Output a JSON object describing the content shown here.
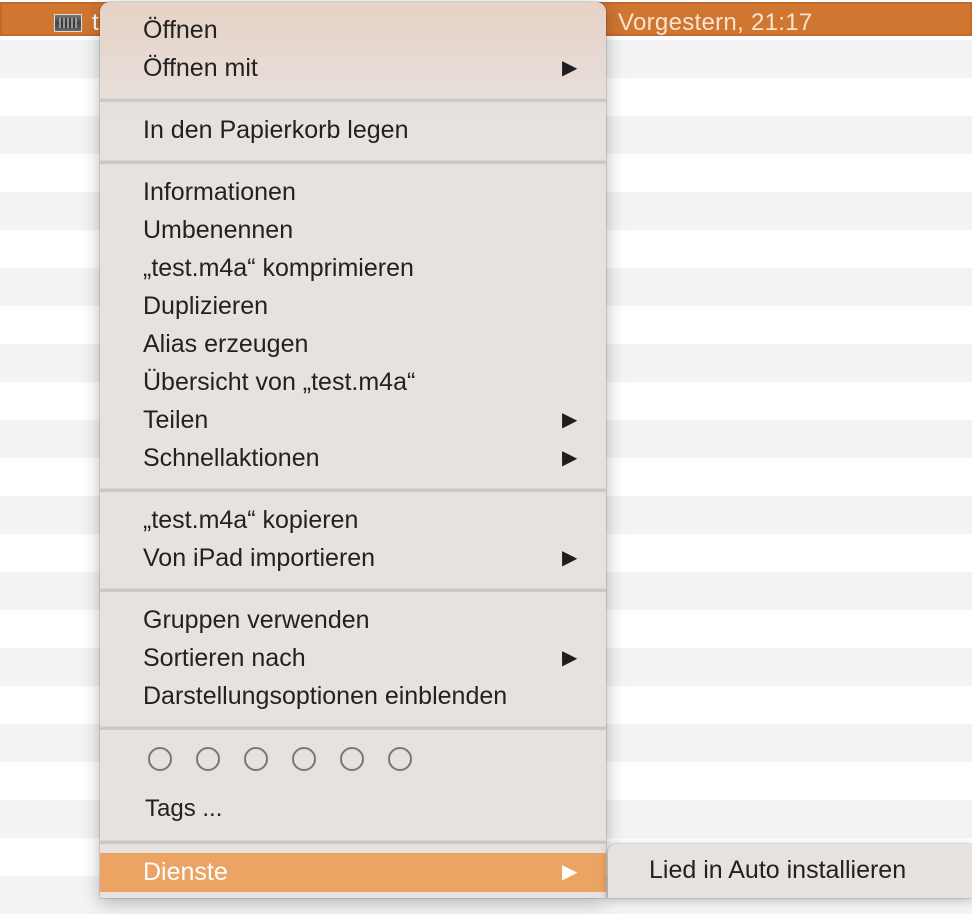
{
  "finder": {
    "selected_file": {
      "name_visible": "t",
      "date": "Vorgestern, 21:17"
    }
  },
  "context_menu": {
    "groups": [
      [
        {
          "label": "Öffnen",
          "has_submenu": false
        },
        {
          "label": "Öffnen mit",
          "has_submenu": true
        }
      ],
      [
        {
          "label": "In den Papierkorb legen",
          "has_submenu": false
        }
      ],
      [
        {
          "label": "Informationen",
          "has_submenu": false
        },
        {
          "label": "Umbenennen",
          "has_submenu": false
        },
        {
          "label": "„test.m4a“ komprimieren",
          "has_submenu": false
        },
        {
          "label": "Duplizieren",
          "has_submenu": false
        },
        {
          "label": "Alias erzeugen",
          "has_submenu": false
        },
        {
          "label": "Übersicht von „test.m4a“",
          "has_submenu": false
        },
        {
          "label": "Teilen",
          "has_submenu": true
        },
        {
          "label": "Schnellaktionen",
          "has_submenu": true
        }
      ],
      [
        {
          "label": "„test.m4a“ kopieren",
          "has_submenu": false
        },
        {
          "label": "Von iPad importieren",
          "has_submenu": true
        }
      ],
      [
        {
          "label": "Gruppen verwenden",
          "has_submenu": false
        },
        {
          "label": "Sortieren nach",
          "has_submenu": true
        },
        {
          "label": "Darstellungsoptionen einblenden",
          "has_submenu": false
        }
      ]
    ],
    "tags": {
      "circle_count": 6,
      "label": "Tags ..."
    },
    "services": {
      "label": "Dienste",
      "has_submenu": true,
      "highlighted": true
    },
    "arrow_glyph": "▶"
  },
  "services_submenu": {
    "items": [
      {
        "label": "Lied in Auto installieren"
      }
    ]
  },
  "colors": {
    "selection": "#cf7631",
    "highlight": "#eba463",
    "menu_bg": "#e7e2de"
  }
}
